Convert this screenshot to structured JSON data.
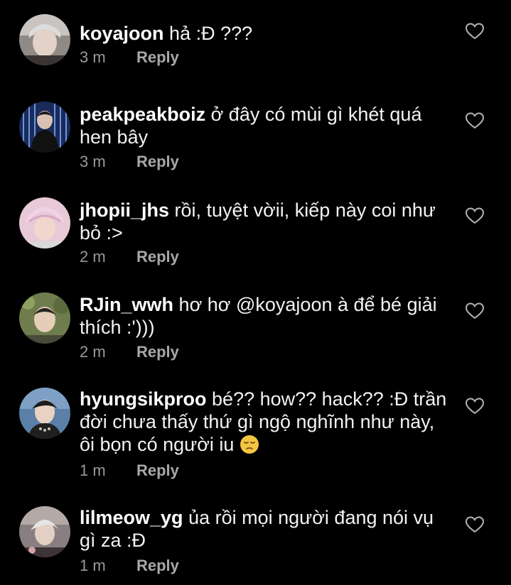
{
  "colors": {
    "background": "#000000",
    "text": "#f2f2f2",
    "username": "#ffffff",
    "meta": "#9a9a9a",
    "heart_outline": "#b3b3b3"
  },
  "comments": [
    {
      "username": "koyajoon",
      "text": "hả :Đ ???",
      "time": "3 m",
      "reply": "Reply",
      "like_icon": "heart-outline-icon"
    },
    {
      "username": "peakpeakboiz",
      "text": "ở đây có mùi gì khét quá hen bây",
      "time": "3 m",
      "reply": "Reply",
      "like_icon": "heart-outline-icon"
    },
    {
      "username": "jhopii_jhs",
      "text": "rồi, tuyệt vờii, kiếp này coi như bỏ :>",
      "time": "2 m",
      "reply": "Reply",
      "like_icon": "heart-outline-icon"
    },
    {
      "username": "RJin_wwh",
      "text": "hơ hơ @koyajoon à để bé giải thích :')))",
      "time": "2 m",
      "reply": "Reply",
      "like_icon": "heart-outline-icon"
    },
    {
      "username": "hyungsikproo",
      "text": "bé?? how?? hack?? :Đ trần đời chưa thấy thứ gì ngộ nghĩnh như này, ôi bọn có người iu",
      "emoji": "pensive-face-emoji",
      "time": "1 m",
      "reply": "Reply",
      "like_icon": "heart-outline-icon"
    },
    {
      "username": "lilmeow_yg",
      "text": "ủa rồi mọi người đang nói vụ gì za :Đ",
      "time": "1 m",
      "reply": "Reply",
      "like_icon": "heart-outline-icon"
    }
  ]
}
